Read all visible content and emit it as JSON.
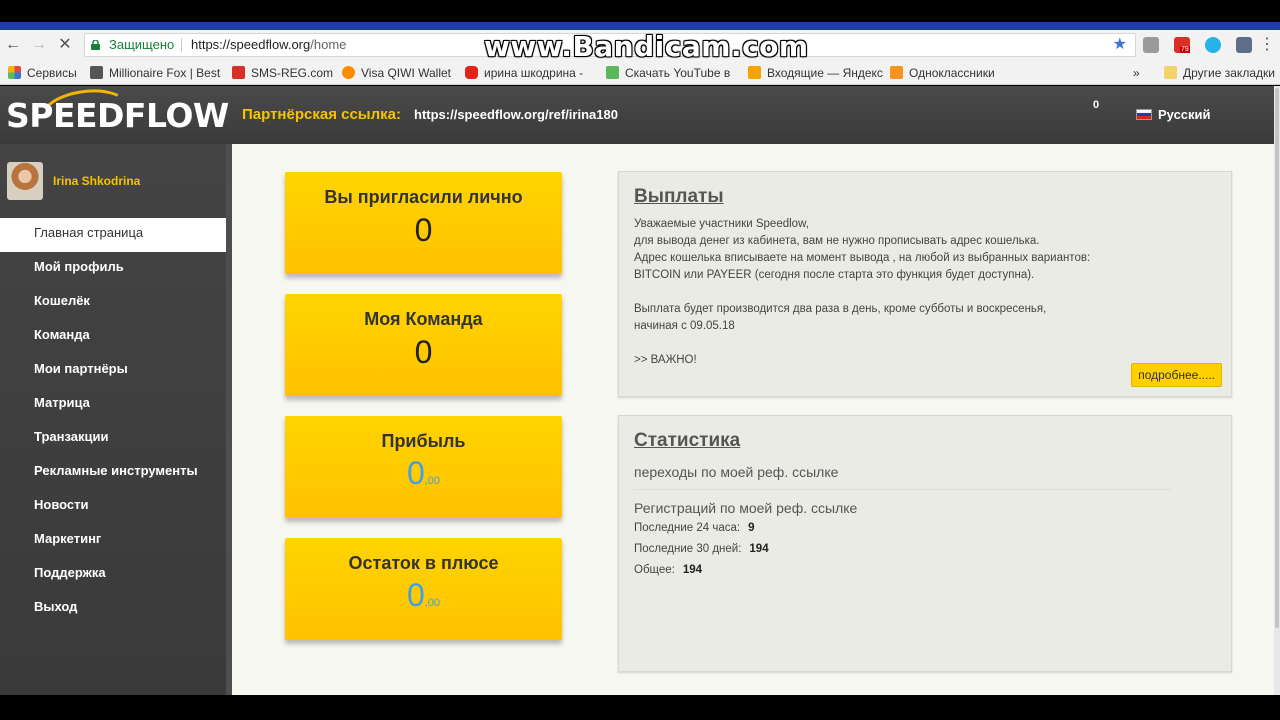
{
  "browser": {
    "secure_label": "Защищено",
    "url_host": "https://speedflow.org",
    "url_path": "/home",
    "watermark": "www.Bandicam.com",
    "badge_count": "79"
  },
  "bookmarks": [
    {
      "label": "Сервисы",
      "color": "#e04b3a"
    },
    {
      "label": "Millionaire Fox | Best",
      "color": "#555555"
    },
    {
      "label": "SMS-REG.com",
      "color": "#d93025"
    },
    {
      "label": "Visa QIWI Wallet",
      "color": "#ff8c00"
    },
    {
      "label": "ирина шкодрина -",
      "color": "#e62117"
    },
    {
      "label": "Скачать YouTube в",
      "color": "#5cb85c"
    },
    {
      "label": "Входящие — Яндекс",
      "color": "#f4a300"
    },
    {
      "label": "Одноклассники",
      "color": "#f7931e"
    },
    {
      "label": "Другие закладки",
      "color": "#f5d36b"
    }
  ],
  "header": {
    "logo": "SPEEDFLOW",
    "partner_label": "Партнёрская ссылка:",
    "partner_link": "https://speedflow.org/ref/irina180",
    "notif_count": "0",
    "language": "Русский"
  },
  "sidebar": {
    "username": "Irina Shkodrina",
    "items": [
      {
        "label": "Главная страница"
      },
      {
        "label": "Мой профиль"
      },
      {
        "label": "Кошелёк"
      },
      {
        "label": "Команда"
      },
      {
        "label": "Мои партнёры"
      },
      {
        "label": "Матрица"
      },
      {
        "label": "Транзакции"
      },
      {
        "label": "Рекламные инструменты"
      },
      {
        "label": "Новости"
      },
      {
        "label": "Маркетинг"
      },
      {
        "label": "Поддержка"
      },
      {
        "label": "Выход"
      }
    ]
  },
  "cards": [
    {
      "title": "Вы пригласили лично",
      "value": "0"
    },
    {
      "title": "Моя Команда",
      "value": "0"
    },
    {
      "title": "Прибыль",
      "value": "0",
      "cents": ",00"
    },
    {
      "title": "Остаток в плюсе",
      "value": "0",
      "cents": ",00"
    }
  ],
  "payouts": {
    "title": "Выплаты",
    "lines": [
      "Уважаемые участники Speedlow,",
      "для вывода денег из кабинета, вам не нужно прописывать адрес кошелька.",
      "Адрес кошелька вписываете на момент вывода , на любой из выбранных вариантов:",
      "BITCOIN или PAYEER (сегодня после старта это функция будет доступна).",
      "",
      "Выплата будет производится два раза в день, кроме субботы и воскресенья,",
      "начиная с 09.05.18",
      "",
      ">> ВАЖНО!"
    ],
    "more_button": "подробнее....."
  },
  "statistics": {
    "title": "Статистика",
    "clicks_label": "переходы по моей реф. ссылке",
    "registrations_label": "Регистраций по моей реф. ссылке",
    "rows": [
      {
        "label": "Последние 24 часа:",
        "value": "9"
      },
      {
        "label": "Последние 30 дней:",
        "value": "194"
      },
      {
        "label": "Общее:",
        "value": "194"
      }
    ]
  }
}
